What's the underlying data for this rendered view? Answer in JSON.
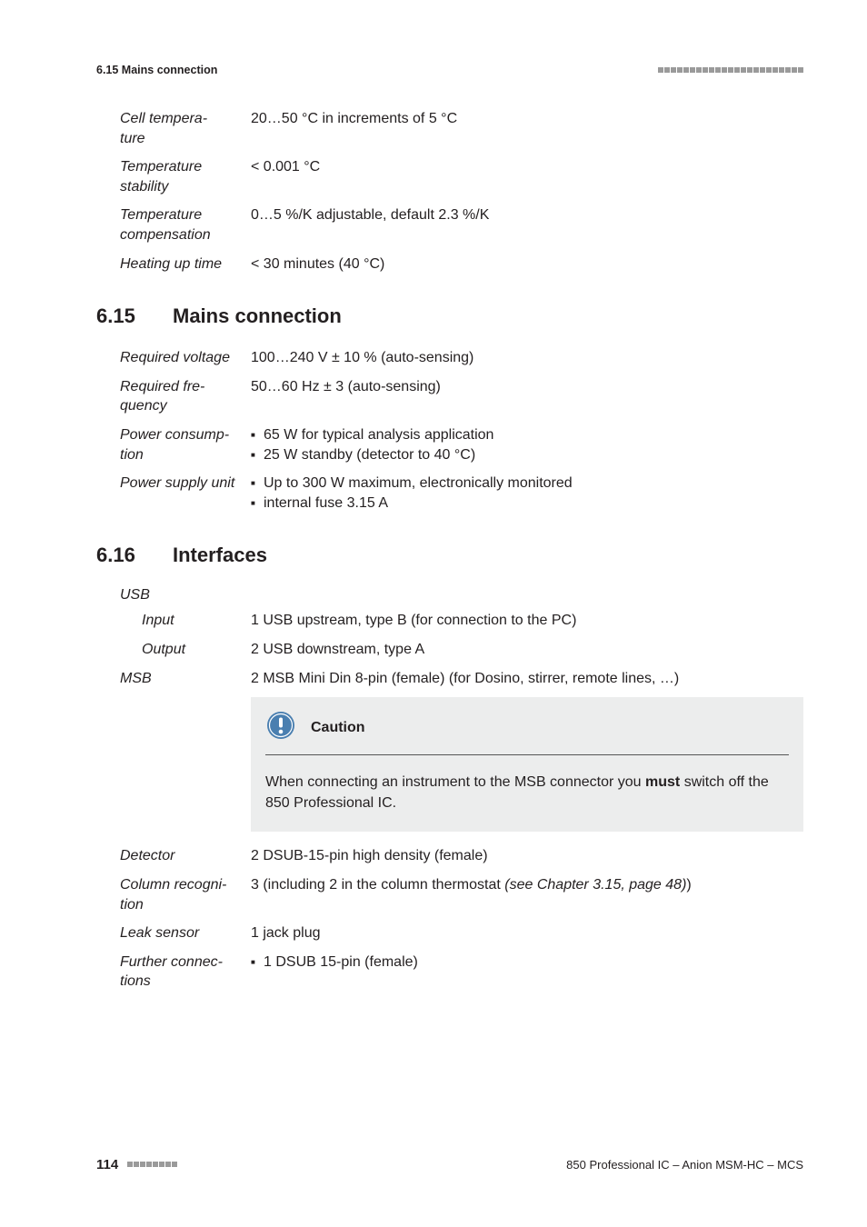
{
  "header": {
    "left": "6.15 Mains connection"
  },
  "topSpecs": [
    {
      "label": "Cell tempera-\nture",
      "value": "20…50 °C in increments of 5 °C"
    },
    {
      "label": "Temperature stability",
      "value": "< 0.001 °C"
    },
    {
      "label": "Temperature compensation",
      "value": "0…5 %/K adjustable, default 2.3 %/K"
    },
    {
      "label": "Heating up time",
      "value": "< 30 minutes (40 °C)"
    }
  ],
  "section615": {
    "number": "6.15",
    "title": "Mains connection",
    "rows": [
      {
        "label": "Required voltage",
        "value": "100…240 V ± 10 % (auto-sensing)"
      },
      {
        "label": "Required fre-\nquency",
        "value": "50…60 Hz ± 3 (auto-sensing)"
      },
      {
        "label": "Power consump-\ntion",
        "list": [
          "65 W for typical analysis application",
          "25 W standby (detector to 40 °C)"
        ]
      },
      {
        "label": "Power supply unit",
        "list": [
          "Up to 300 W maximum, electronically monitored",
          "internal fuse 3.15 A"
        ]
      }
    ]
  },
  "section616": {
    "number": "6.16",
    "title": "Interfaces",
    "usbLabel": "USB",
    "usbRows": [
      {
        "label": "Input",
        "value": "1 USB upstream, type B (for connection to the PC)"
      },
      {
        "label": "Output",
        "value": "2 USB downstream, type A"
      }
    ],
    "msb": {
      "label": "MSB",
      "value": "2 MSB Mini Din 8-pin (female) (for Dosino, stirrer, remote lines, …)"
    },
    "caution": {
      "title": "Caution",
      "body_pre": "When connecting an instrument to the MSB connector you ",
      "body_bold": "must",
      "body_post": " switch off the 850 Professional IC."
    },
    "rows2": [
      {
        "label": "Detector",
        "value": "2 DSUB-15-pin high density (female)"
      },
      {
        "label": "Column recogni-\ntion",
        "value_pre": "3 (including 2 in the column thermostat ",
        "xref": "(see Chapter 3.15, page 48)",
        "value_post": ")"
      },
      {
        "label": "Leak sensor",
        "value": "1 jack plug"
      },
      {
        "label": "Further connec-\ntions",
        "list": [
          "1 DSUB 15-pin (female)"
        ]
      }
    ]
  },
  "footer": {
    "pageNumber": "114",
    "docTitle": "850 Professional IC – Anion MSM-HC – MCS"
  }
}
